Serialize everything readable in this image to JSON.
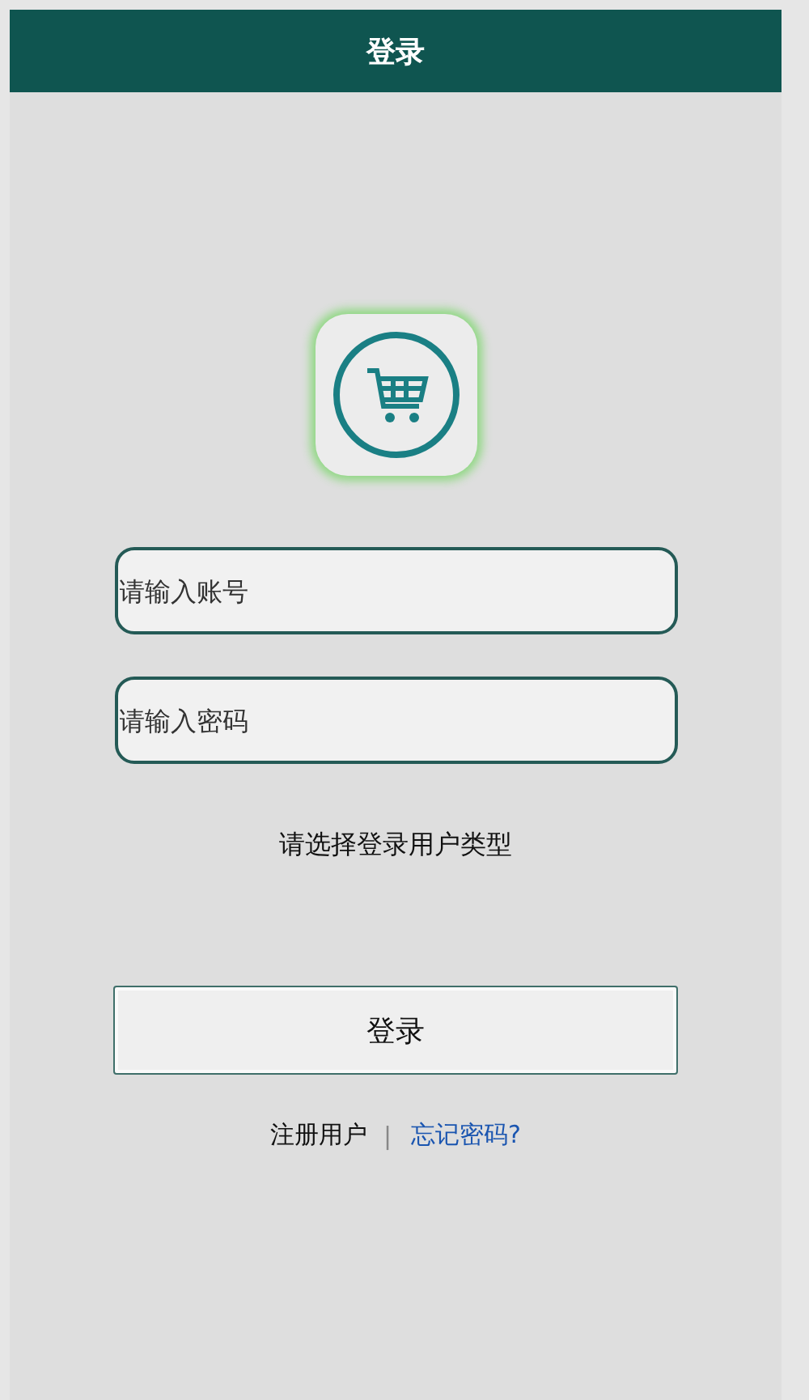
{
  "header": {
    "title": "登录"
  },
  "fields": [
    {
      "placeholder": "请输入账号"
    },
    {
      "placeholder": "请输入密码"
    }
  ],
  "user_type_prompt": "请选择登录用户类型",
  "login_button": "登录",
  "links": [
    {
      "label": "注册用户",
      "kind": "plain"
    },
    {
      "label": "|",
      "kind": "separator"
    },
    {
      "label": "忘记密码?",
      "kind": "link"
    }
  ]
}
